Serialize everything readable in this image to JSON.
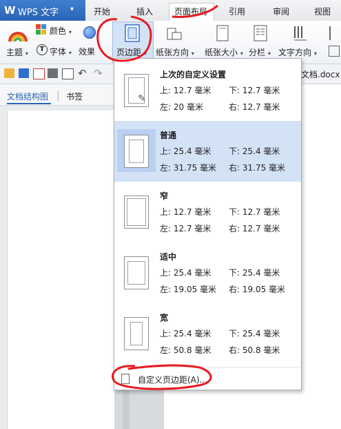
{
  "app": {
    "logo": "W",
    "name": "WPS 文字",
    "menu_caret": "▾"
  },
  "tabs": [
    {
      "label": "开始"
    },
    {
      "label": "插入"
    },
    {
      "label": "页面布局"
    },
    {
      "label": "引用"
    },
    {
      "label": "审阅"
    },
    {
      "label": "视图"
    }
  ],
  "ribbon": {
    "color_label": "颜色",
    "theme_label": "主题",
    "font_label": "字体",
    "effect_label": "效果",
    "margins_label": "页边距",
    "orientation_label": "纸张方向",
    "size_label": "纸张大小",
    "columns_label": "分栏",
    "text_direction_label": "文字方向",
    "caret": "▾"
  },
  "document": {
    "title_fragment": "文档.docx"
  },
  "nav": {
    "outline_tab": "文档结构图",
    "bookmark_tab": "书签"
  },
  "margins_menu": {
    "options": [
      {
        "name": "上次的自定义设置",
        "top": "上: 12.7 毫米",
        "bottom": "下: 12.7 毫米",
        "left": "左: 20 毫米",
        "right": "右: 12.7 毫米"
      },
      {
        "name": "普通",
        "top": "上: 25.4 毫米",
        "bottom": "下: 25.4 毫米",
        "left": "左: 31.75 毫米",
        "right": "右: 31.75 毫米"
      },
      {
        "name": "窄",
        "top": "上: 12.7 毫米",
        "bottom": "下: 12.7 毫米",
        "left": "左: 12.7 毫米",
        "right": "右: 12.7 毫米"
      },
      {
        "name": "适中",
        "top": "上: 25.4 毫米",
        "bottom": "下: 25.4 毫米",
        "left": "左: 19.05 毫米",
        "right": "右: 19.05 毫米"
      },
      {
        "name": "宽",
        "top": "上: 25.4 毫米",
        "bottom": "下: 25.4 毫米",
        "left": "左: 50.8 毫米",
        "right": "右: 50.8 毫米"
      }
    ],
    "selected": "普通",
    "custom_label": "自定义页边距(A)..."
  },
  "colors": {
    "accent": "#2a63b4",
    "selection": "#d4e2f6",
    "annotation": "#e8191f"
  }
}
